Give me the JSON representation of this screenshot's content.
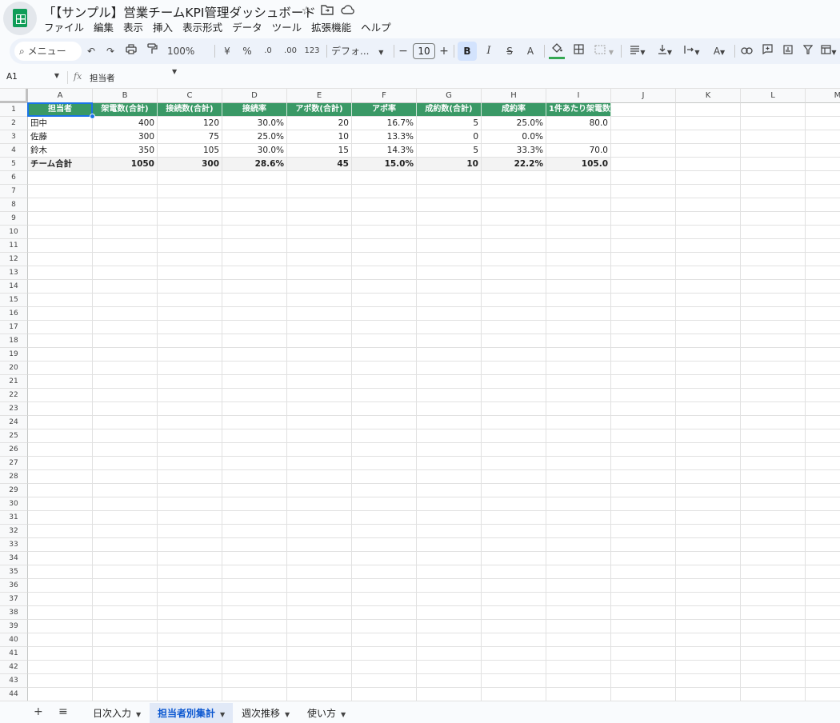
{
  "title": "「【サンプル】営業チームKPI管理ダッシュボード",
  "menu": [
    "ファイル",
    "編集",
    "表示",
    "挿入",
    "表示形式",
    "データ",
    "ツール",
    "拡張機能",
    "ヘルプ"
  ],
  "toolbar": {
    "menu_search": "メニュー",
    "zoom": "100%",
    "currency": "¥",
    "percent": "%",
    "dec_decrease": ".0",
    "dec_increase": ".00",
    "number_format": "123",
    "font": "デフォ...",
    "font_size": "10",
    "bold": "B",
    "italic": "I",
    "strike": "S",
    "text_color": "A"
  },
  "formula_bar": {
    "cell_ref": "A1",
    "fx": "fx",
    "content": "担当者"
  },
  "grid": {
    "columns": [
      "A",
      "B",
      "C",
      "D",
      "E",
      "F",
      "G",
      "H",
      "I",
      "J",
      "K",
      "L",
      "M"
    ],
    "headers": [
      "担当者",
      "架電数(合計)",
      "接続数(合計)",
      "接続率",
      "アポ数(合計)",
      "アポ率",
      "成約数(合計)",
      "成約率",
      "1件あたり架電数"
    ],
    "rows": [
      [
        "田中",
        "400",
        "120",
        "30.0%",
        "20",
        "16.7%",
        "5",
        "25.0%",
        "80.0"
      ],
      [
        "佐藤",
        "300",
        "75",
        "25.0%",
        "10",
        "13.3%",
        "0",
        "0.0%",
        ""
      ],
      [
        "鈴木",
        "350",
        "105",
        "30.0%",
        "15",
        "14.3%",
        "5",
        "33.3%",
        "70.0"
      ]
    ],
    "total": [
      "チーム合計",
      "1050",
      "300",
      "28.6%",
      "45",
      "15.0%",
      "10",
      "22.2%",
      "105.0"
    ],
    "row_count": 44
  },
  "tabs": [
    {
      "label": "日次入力",
      "active": false
    },
    {
      "label": "担当者別集計",
      "active": true
    },
    {
      "label": "週次推移",
      "active": false
    },
    {
      "label": "使い方",
      "active": false
    }
  ],
  "colors": {
    "header_fill": "#3a9966",
    "active_tab": "#0b57d0",
    "selection": "#1a73e8"
  }
}
